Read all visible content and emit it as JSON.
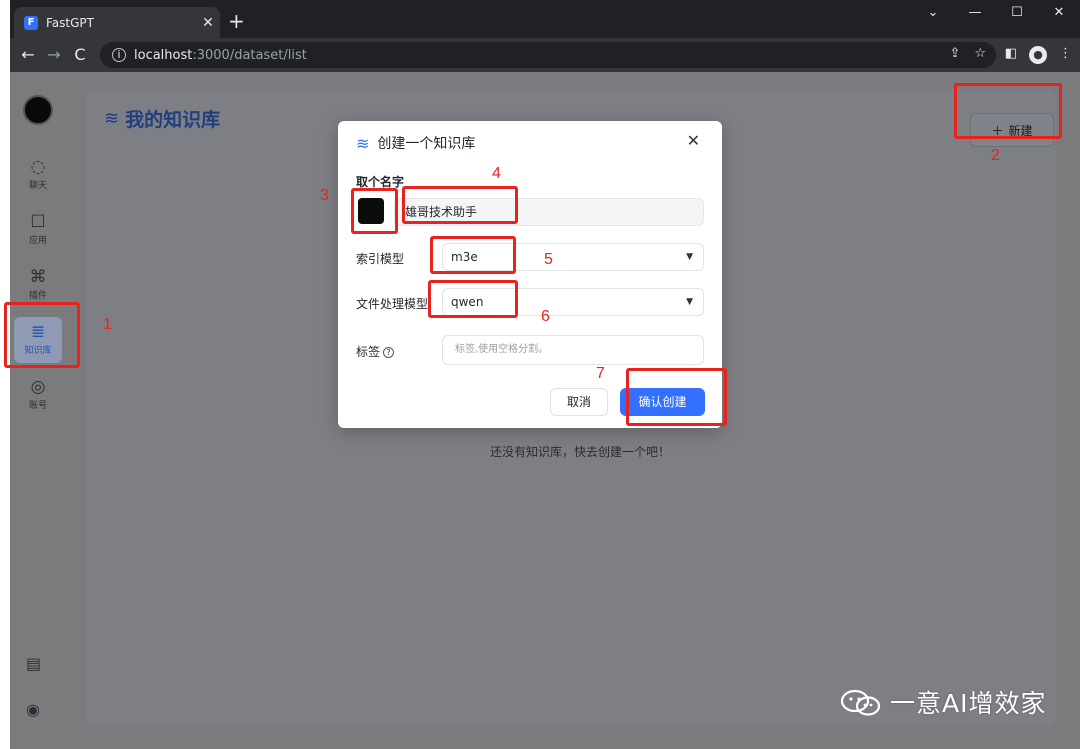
{
  "browser": {
    "tab_title": "FastGPT",
    "tab_close": "✕",
    "new_tab": "+",
    "address_host": "localhost",
    "address_path": ":3000/dataset/list",
    "window_controls": [
      "⌄",
      "—",
      "☐",
      "✕"
    ]
  },
  "sidebar": {
    "items": [
      {
        "label": "聊天",
        "icon": "chat-icon"
      },
      {
        "label": "应用",
        "icon": "robot-icon"
      },
      {
        "label": "插件",
        "icon": "plugin-icon"
      },
      {
        "label": "知识库",
        "icon": "database-icon",
        "active": true
      },
      {
        "label": "账号",
        "icon": "user-icon"
      }
    ]
  },
  "page": {
    "title": "我的知识库",
    "new_button": "新建",
    "empty_text": "还没有知识库，快去创建一个吧！"
  },
  "modal": {
    "title": "创建一个知识库",
    "name_label": "取个名字",
    "name_value": "雄哥技术助手",
    "index_model_label": "索引模型",
    "index_model_value": "m3e",
    "file_model_label": "文件处理模型",
    "file_model_value": "qwen",
    "tags_label": "标签",
    "tags_placeholder": "标签,使用空格分割。",
    "cancel": "取消",
    "confirm": "确认创建"
  },
  "annotations": [
    "1",
    "2",
    "3",
    "4",
    "5",
    "6",
    "7"
  ],
  "watermark": "一意AI增效家",
  "colors": {
    "accent": "#3370ff",
    "annotation_red": "#e8231d",
    "page_title": "#1e3f80"
  }
}
